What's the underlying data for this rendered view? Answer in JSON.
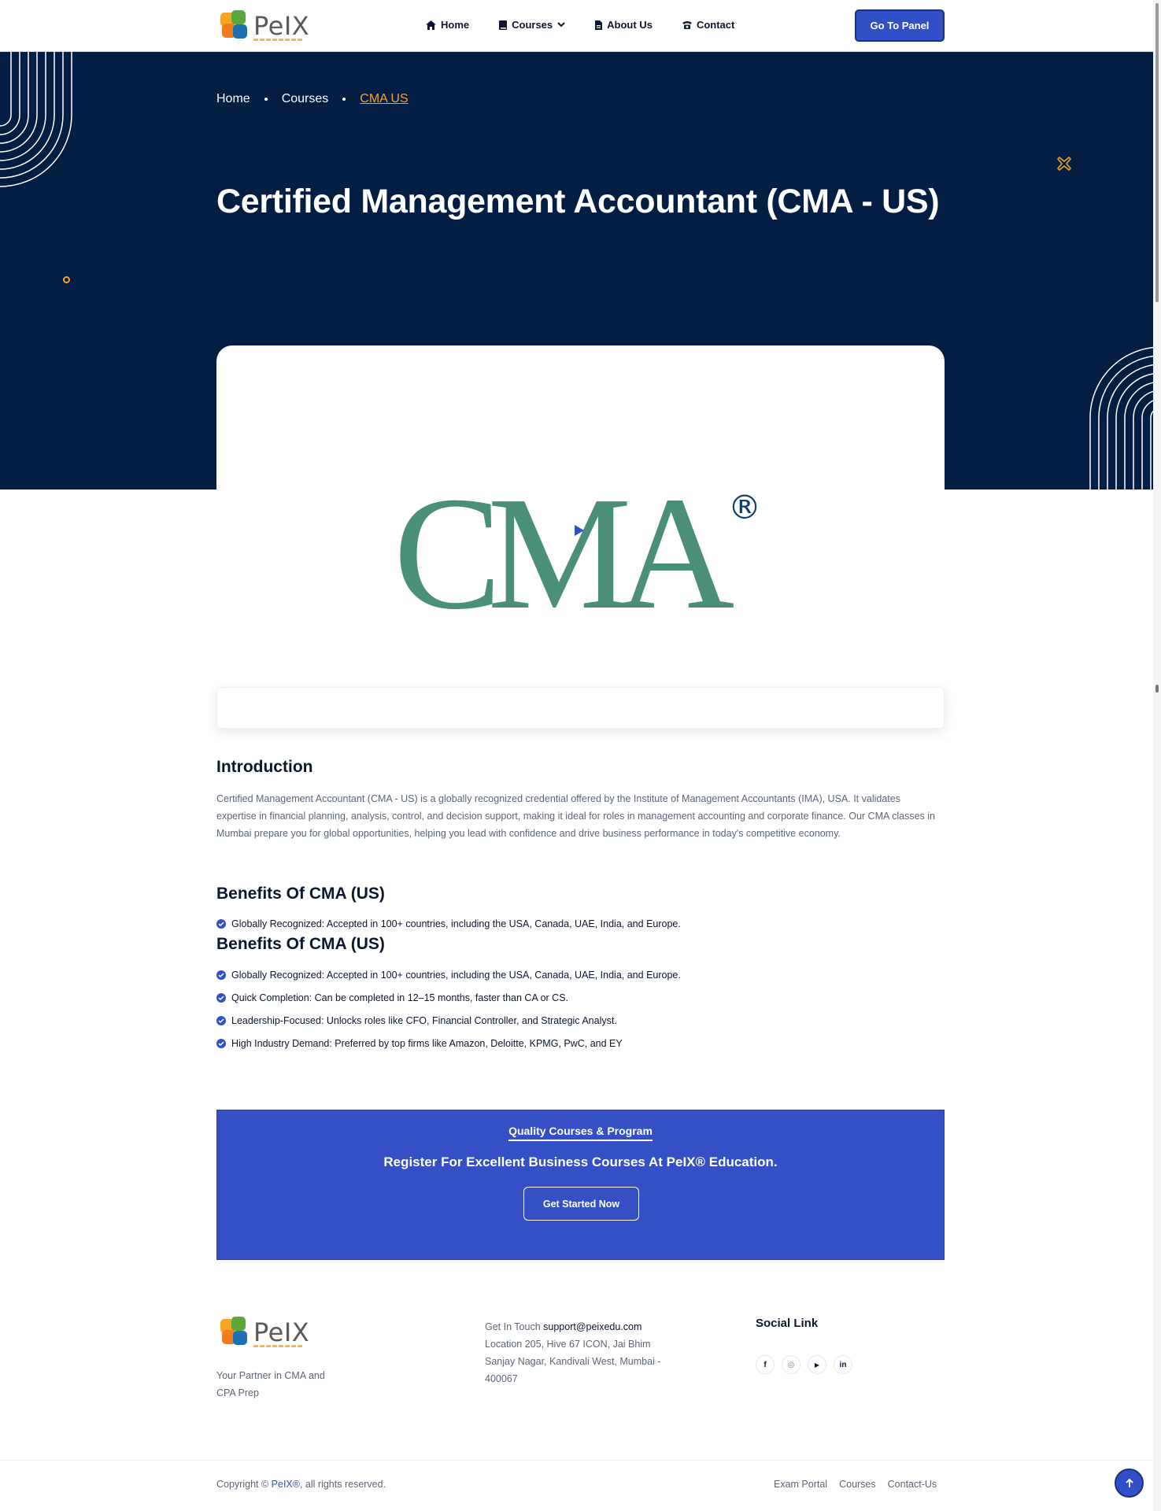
{
  "header": {
    "logo_text": "PeIX",
    "nav": [
      {
        "label": "Home",
        "icon": "home-icon"
      },
      {
        "label": "Courses",
        "icon": "book-icon"
      },
      {
        "label": "About Us",
        "icon": "document-icon"
      },
      {
        "label": "Contact",
        "icon": "phone-icon"
      }
    ],
    "panel_button": "Go To Panel"
  },
  "hero": {
    "breadcrumb": [
      "Home",
      "Courses",
      "CMA US"
    ],
    "title": "Certified Management Accountant (CMA - US)"
  },
  "media": {
    "logo_text": "CMA",
    "registered_mark": "®"
  },
  "content": {
    "intro_heading": "Introduction",
    "intro_text": "Certified Management Accountant (CMA - US) is a globally recognized credential offered by the Institute of Management Accountants (IMA), USA. It validates expertise in financial planning, analysis, control, and decision support, making it ideal for roles in management accounting and corporate finance. Our CMA classes in Mumbai prepare you for global opportunities, helping you lead with confidence and drive business performance in today's competitive economy.",
    "benefits_heading": "Benefits Of CMA (US)",
    "benefits_first": [
      "Globally Recognized: Accepted in 100+ countries, including the USA, Canada, UAE, India, and Europe."
    ],
    "benefits_heading_2": "Benefits Of CMA (US)",
    "benefits": [
      "Globally Recognized: Accepted in 100+ countries, including the USA, Canada, UAE, India, and Europe.",
      "Quick Completion: Can be completed in 12–15 months, faster than CA or CS.",
      "Leadership-Focused: Unlocks roles like CFO, Financial Controller, and Strategic Analyst.",
      "High Industry Demand: Preferred by top firms like Amazon, Deloitte, KPMG, PwC, and EY"
    ]
  },
  "cta": {
    "kicker": "Quality Courses & Program",
    "title": "Register For Excellent Business Courses At PeIX® Education.",
    "button": "Get Started Now"
  },
  "footer": {
    "tagline": "Your Partner in CMA and CPA Prep",
    "contact_label": "Get In Touch",
    "email": "support@peixedu.com",
    "address": "Location 205, Hive 67 ICON, Jai Bhim Sanjay Nagar, Kandivali West, Mumbai - 400067",
    "social_title": "Social Link",
    "socials": [
      {
        "icon": "facebook-icon",
        "glyph": "f"
      },
      {
        "icon": "instagram-icon",
        "glyph": "◎"
      },
      {
        "icon": "youtube-icon",
        "glyph": "▶"
      },
      {
        "icon": "linkedin-icon",
        "glyph": "in"
      }
    ],
    "copyright_prefix": "Copyright ©",
    "copyright_brand": "PeIX®",
    "copyright_suffix": ", all rights reserved.",
    "links": [
      "Exam Portal",
      "Courses",
      "Contact-Us"
    ]
  },
  "colors": {
    "hero_bg": "#041d43",
    "accent_blue": "#3150c8",
    "accent_orange": "#f7a522",
    "cma_green": "#4a8f78",
    "cma_navy": "#0b3a6b"
  }
}
